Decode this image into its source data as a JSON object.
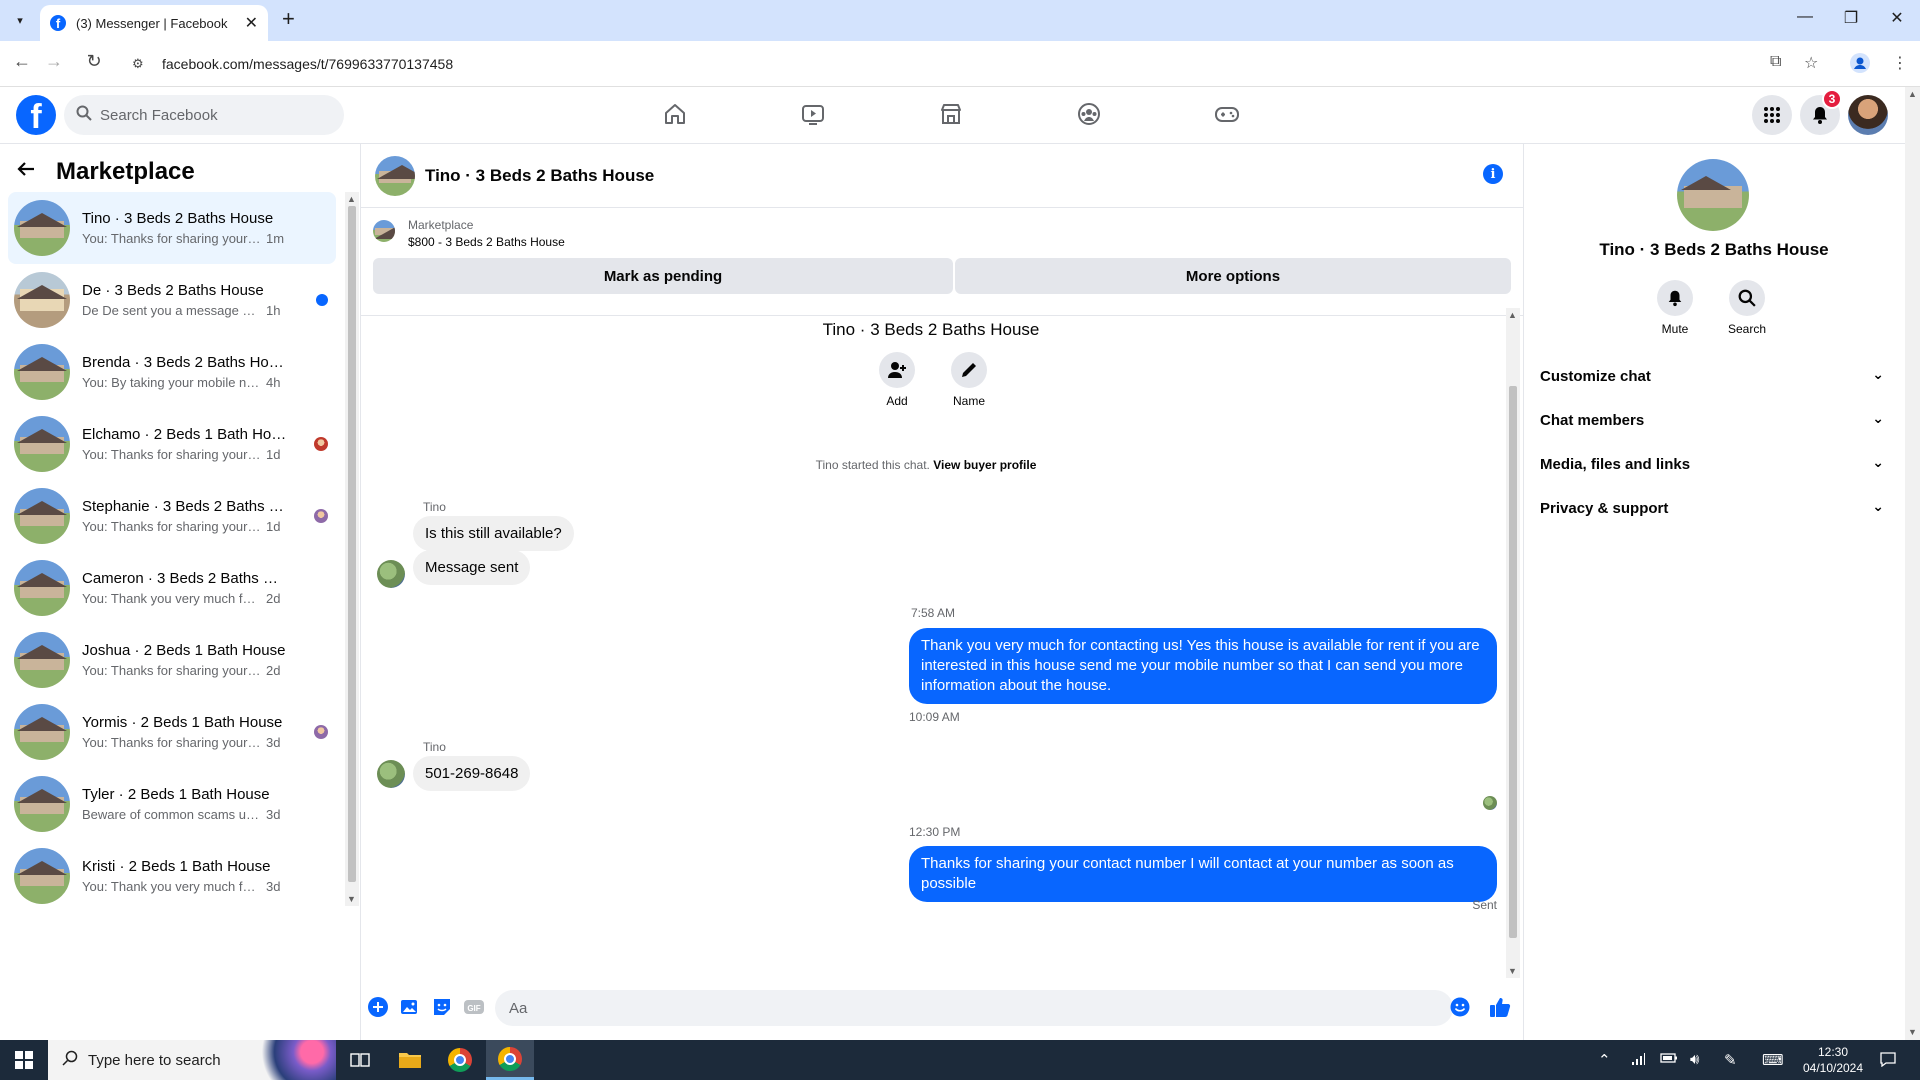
{
  "browser": {
    "tab_title": "(3) Messenger | Facebook",
    "url": "facebook.com/messages/t/7699633770137458"
  },
  "fb_header": {
    "search_placeholder": "Search Facebook",
    "notification_count": "3",
    "nav_icons": [
      "home-icon",
      "video-icon",
      "marketplace-icon",
      "groups-icon",
      "gaming-icon"
    ]
  },
  "sidebar": {
    "title": "Marketplace",
    "conversations": [
      {
        "name": "Tino · 3 Beds 2 Baths House",
        "preview": "You: Thanks for sharing your conta...",
        "time": "1m",
        "active": true,
        "indicator": "none",
        "avatar": "house"
      },
      {
        "name": "De · 3 Beds 2 Baths House",
        "preview": "De De sent you a message abou...",
        "time": "1h",
        "active": false,
        "indicator": "unread",
        "avatar": "mobile"
      },
      {
        "name": "Brenda · 3 Beds 2 Baths House",
        "preview": "You: By taking your mobile number...",
        "time": "4h",
        "active": false,
        "indicator": "none",
        "avatar": "house"
      },
      {
        "name": "Elchamo · 2 Beds 1 Bath House",
        "preview": "You: Thanks for sharing your co...",
        "time": "1d",
        "active": false,
        "indicator": "seen",
        "avatar": "house"
      },
      {
        "name": "Stephanie · 3 Beds 2 Baths Ho...",
        "preview": "You: Thanks for sharing your co...",
        "time": "1d",
        "active": false,
        "indicator": "seen",
        "avatar": "house"
      },
      {
        "name": "Cameron · 3 Beds 2 Baths House",
        "preview": "You: Thank you very much for cont...",
        "time": "2d",
        "active": false,
        "indicator": "none",
        "avatar": "house"
      },
      {
        "name": "Joshua · 2 Beds 1 Bath House",
        "preview": "You: Thanks for sharing your conta...",
        "time": "2d",
        "active": false,
        "indicator": "none",
        "avatar": "house"
      },
      {
        "name": "Yormis · 2 Beds 1 Bath House",
        "preview": "You: Thanks for sharing your co...",
        "time": "3d",
        "active": false,
        "indicator": "seen",
        "avatar": "house"
      },
      {
        "name": "Tyler · 2 Beds 1 Bath House",
        "preview": "Beware of common scams using p...",
        "time": "3d",
        "active": false,
        "indicator": "none",
        "avatar": "house"
      },
      {
        "name": "Kristi · 2 Beds 1 Bath House",
        "preview": "You: Thank you very much for cont...",
        "time": "3d",
        "active": false,
        "indicator": "none",
        "avatar": "house"
      }
    ]
  },
  "chat": {
    "header_name": "Tino · 3 Beds 2 Baths House",
    "marketplace_label": "Marketplace",
    "listing": "$800 - 3 Beds 2 Baths House",
    "mark_pending_label": "Mark as pending",
    "more_options_label": "More options",
    "intro_name": "Tino · 3 Beds 2 Baths House",
    "intro_add_label": "Add",
    "intro_name_label": "Name",
    "system_text": "Tino started this chat.",
    "system_link": "View buyer profile",
    "sender_1": "Tino",
    "msg_in_1": "Is this still available?",
    "msg_in_2": "Message sent",
    "time_1": "7:58 AM",
    "msg_out_1": "Thank you very much for contacting us! Yes this house is available for rent if you are interested in this house send me your mobile number so that I can send you more information about the house.",
    "time_2": "10:09 AM",
    "sender_2": "Tino",
    "msg_in_3": "501-269-8648",
    "time_3": "12:30 PM",
    "msg_out_2": "Thanks for sharing your contact number I will contact at your number as soon as possible",
    "sent_label": "Sent",
    "composer_placeholder": "Aa"
  },
  "info_panel": {
    "name": "Tino · 3 Beds 2 Baths House",
    "mute_label": "Mute",
    "search_label": "Search",
    "sections": [
      "Customize chat",
      "Chat members",
      "Media, files and links",
      "Privacy & support"
    ]
  },
  "taskbar": {
    "search_placeholder": "Type here to search",
    "time": "12:30",
    "date": "04/10/2024"
  },
  "colors": {
    "fb_blue": "#0866ff",
    "active_conv": "#ebf5ff",
    "badge_red": "#e41e3f"
  }
}
